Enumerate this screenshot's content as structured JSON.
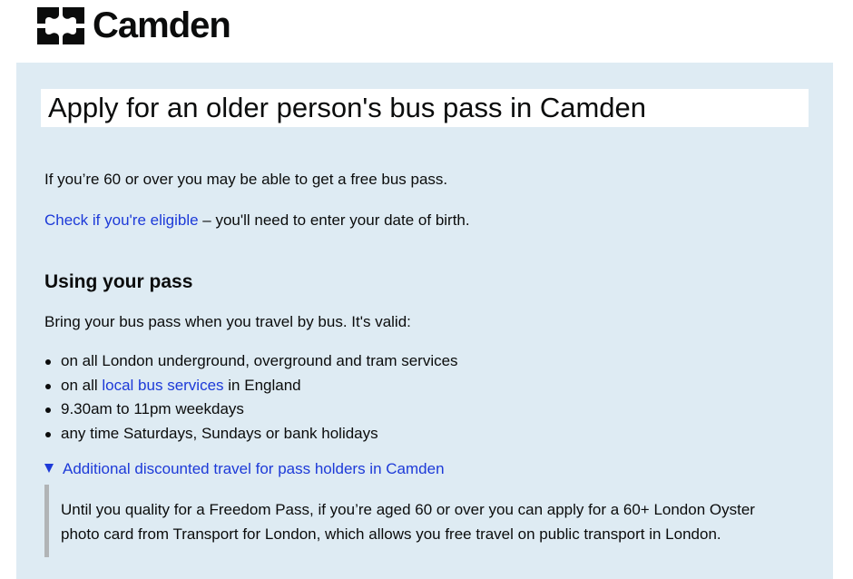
{
  "header": {
    "logo_text": "Camden",
    "logo_icon": "camden-emblem-icon"
  },
  "main": {
    "title": "Apply for an older person's bus pass in Camden",
    "intro": "If you’re 60 or over you may be able to get a free bus pass.",
    "eligibility_link": "Check if you're eligible",
    "eligibility_rest": " – you'll need to enter your date of birth.",
    "section_heading": "Using your pass",
    "section_intro": "Bring your bus pass when you travel by bus. It's valid:",
    "bullets": {
      "b0": "on all London underground, overground and tram services",
      "b1_prefix": "on all ",
      "b1_link": "local bus services",
      "b1_suffix": " in England",
      "b2": "9.30am to 11pm weekdays",
      "b3": "any time Saturdays, Sundays or bank holidays"
    },
    "details": {
      "summary": "Additional discounted travel for pass holders in Camden",
      "expanded": true,
      "body_line1": "Until you quality for a Freedom Pass, if you’re aged 60 or over you can apply for a 60+ London Oyster",
      "body_line2": "photo card from Transport for London, which allows you free travel on public transport in London."
    }
  },
  "colors": {
    "panel_background": "#deebf3",
    "link": "#1d3ad8",
    "text": "#0b0c0c",
    "details_border": "#b1b4b6"
  }
}
